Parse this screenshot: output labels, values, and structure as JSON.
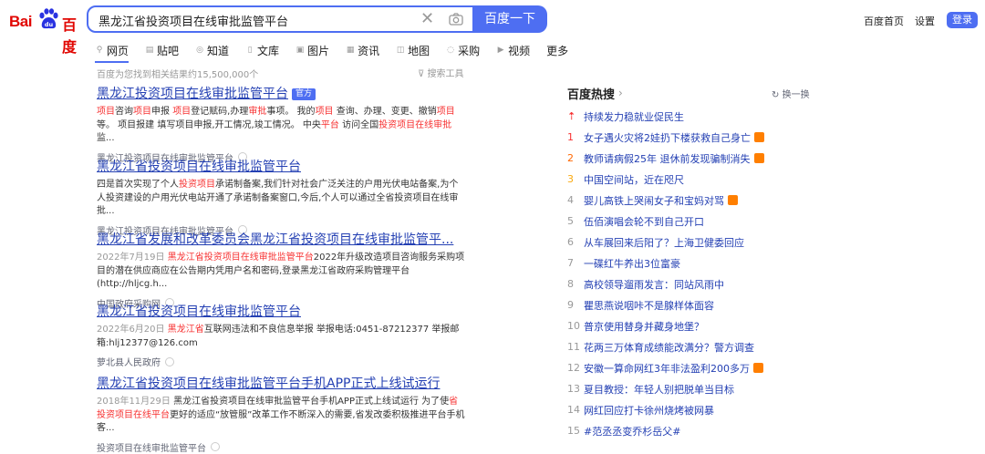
{
  "logo": {
    "text1": "Bai",
    "text2": "百度"
  },
  "search": {
    "query": "黑龙江省投资项目在线审批监管平台",
    "button": "百度一下"
  },
  "topnav": {
    "home": "百度首页",
    "settings": "设置",
    "login": "登录"
  },
  "tabs": [
    {
      "label": "网页",
      "icon": "search-icon"
    },
    {
      "label": "贴吧",
      "icon": "tieba-icon"
    },
    {
      "label": "知道",
      "icon": "zhidao-icon"
    },
    {
      "label": "文库",
      "icon": "wenku-icon"
    },
    {
      "label": "图片",
      "icon": "image-icon"
    },
    {
      "label": "资讯",
      "icon": "news-icon"
    },
    {
      "label": "地图",
      "icon": "map-icon"
    },
    {
      "label": "采购",
      "icon": "purchase-icon"
    },
    {
      "label": "视频",
      "icon": "video-icon"
    },
    {
      "label": "更多",
      "icon": ""
    }
  ],
  "result_count": "百度为您找到相关结果约15,500,000个",
  "search_tools": "搜索工具",
  "results": [
    {
      "title": "黑龙江投资项目在线审批监管平台",
      "badge": "官方",
      "abstract_html": "<em>项目</em>咨询<em>项目</em>申报 <em>项目</em>登记赋码,办理<em>审批</em>事项。 我的<em>项目</em> 查询、办理、变更、撤销<em>项目</em>等。 项目报建 填写项目申报,开工情况,竣工情况。 中央<em>平台</em> 访问全国<em>投资项目在线审批</em>监...",
      "source": "黑龙江投资项目在线审批监管平台"
    },
    {
      "title": "黑龙江省投资项目在线审批监管平台",
      "badge": "",
      "abstract_html": "四是首次实现了个人<em>投资项目</em>承诺制备案,我们针对社会广泛关注的户用光伏电站备案,为个人投资建设的户用光伏电站开通了承诺制备案窗口,今后,个人可以通过全省投资项目在线审批...",
      "source": "黑龙江投资项目在线审批监管平台"
    },
    {
      "title": "黑龙江省发展和改革委员会黑龙江省投资项目在线审批监管平...",
      "badge": "",
      "abstract_html": "<span class=\"date\">2022年7月19日</span> <em>黑龙江省投资项目在线审批监管平台</em>2022年升级改造项目咨询服务采购项目的潜在供应商应在公告期内凭用户名和密码,登录黑龙江省政府采购管理平台(http://hljcg.h...",
      "source": "中国政府采购网"
    },
    {
      "title": "黑龙江省投资项目在线审批监管平台",
      "badge": "",
      "abstract_html": "<span class=\"date\">2022年6月20日</span> <em>黑龙江省</em>互联网违法和不良信息举报 举报电话:0451-87212377 举报邮箱:hlj12377@126.com",
      "source": "萝北县人民政府"
    },
    {
      "title": "黑龙江省投资项目在线审批监管平台手机APP正式上线试运行",
      "badge": "",
      "abstract_html": "<span class=\"date\">2018年11月29日</span> 黑龙江省投资项目在线审批监管平台手机APP正式上线试运行 为了使<em>省投资项目在线平台</em>更好的适应“放管服”改革工作不断深入的需要,省发改委积极推进平台手机客...",
      "source": "投资项目在线审批监管平台"
    }
  ],
  "hot": {
    "title": "百度热搜",
    "refresh": "换一换",
    "hot_tag": "热",
    "items": [
      {
        "num": "",
        "text": "持续发力稳就业促民生",
        "hot": false
      },
      {
        "num": "1",
        "text": "女子遇火灾将2娃扔下楼获救自己身亡",
        "hot": true
      },
      {
        "num": "2",
        "text": "教师请病假25年 退休前发现骗制消失",
        "hot": true
      },
      {
        "num": "3",
        "text": "中国空间站，近在咫尺",
        "hot": false
      },
      {
        "num": "4",
        "text": "婴儿高铁上哭闹女子和宝妈对骂",
        "hot": true
      },
      {
        "num": "5",
        "text": "伍佰演唱会轮不到自己开口",
        "hot": false
      },
      {
        "num": "6",
        "text": "从车展回来后阳了？上海卫健委回应",
        "hot": false
      },
      {
        "num": "7",
        "text": "一碟红牛养出3位富豪",
        "hot": false
      },
      {
        "num": "8",
        "text": "高校领导遛雨发言：同站风雨中",
        "hot": false
      },
      {
        "num": "9",
        "text": "瞿思燕说咽咔不是腺样体面容",
        "hot": false
      },
      {
        "num": "10",
        "text": "普京使用替身并藏身地堡？",
        "hot": false
      },
      {
        "num": "11",
        "text": "花两三万体育成绩能改满分？警方调查",
        "hot": false
      },
      {
        "num": "12",
        "text": "安徽一算命网红3年非法盈利200多万",
        "hot": true
      },
      {
        "num": "13",
        "text": "夏目教授：年轻人别把脱单当目标",
        "hot": false
      },
      {
        "num": "14",
        "text": "网红回应打卡徐州烧烤被网暴",
        "hot": false
      },
      {
        "num": "15",
        "text": "#范丞丞变乔杉岳父#",
        "hot": false
      }
    ]
  },
  "colors": {
    "accent": "#4e6ef2",
    "highlight": "#f73131",
    "link": "#2440b3",
    "logo": "#e10602",
    "hot_tag": "#ff7f00",
    "top_icon": "#f73131",
    "rank_1": "#f73131",
    "rank_2": "#ff6600",
    "rank_3": "#faa90e"
  }
}
